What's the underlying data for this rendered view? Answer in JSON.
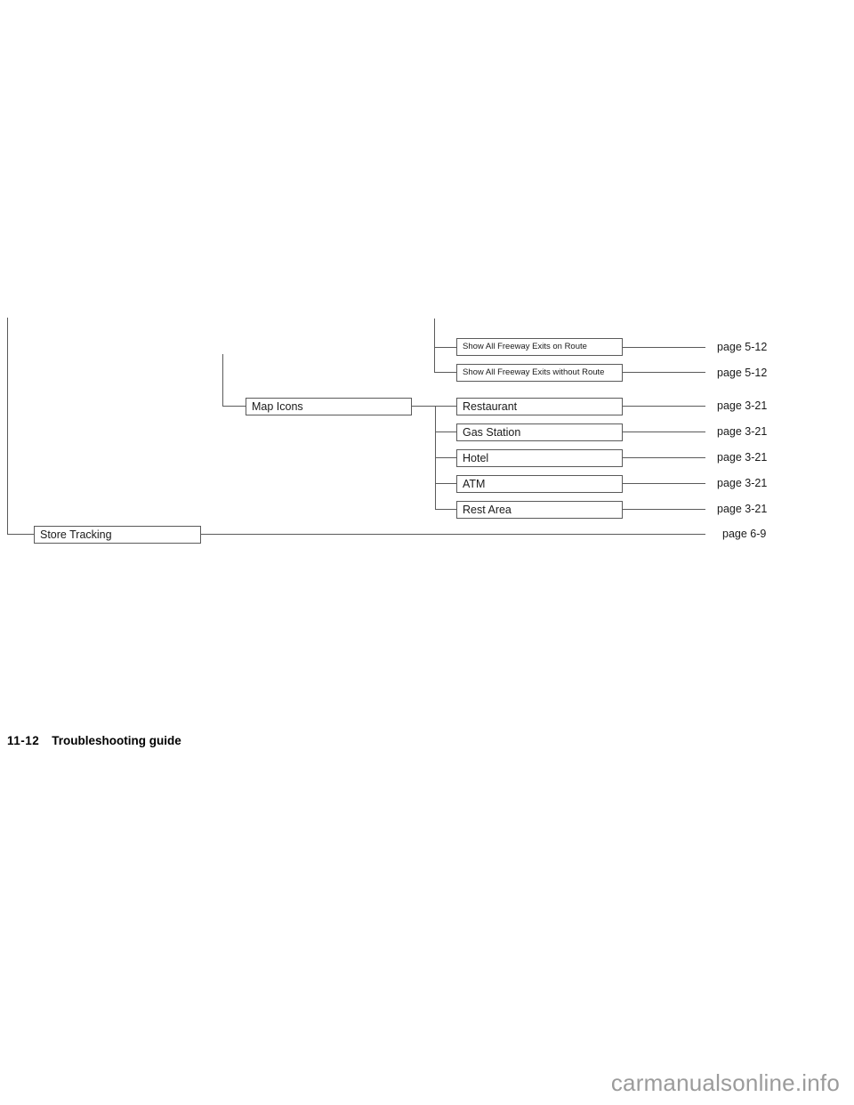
{
  "document": {
    "folio": "11-12",
    "chapter_title": "Troubleshooting guide",
    "watermark": "carmanualsonline.info"
  },
  "diagram": {
    "type": "menu-tree",
    "branches": [
      {
        "id": "freeway-exits",
        "nodes": [
          {
            "label": "Show All Freeway Exits on Route",
            "page_ref": "page 5-12"
          },
          {
            "label": "Show All Freeway Exits without Route",
            "page_ref": "page 5-12"
          }
        ]
      },
      {
        "id": "map-icons",
        "parent": {
          "label": "Map Icons"
        },
        "nodes": [
          {
            "label": "Restaurant",
            "page_ref": "page 3-21"
          },
          {
            "label": "Gas Station",
            "page_ref": "page 3-21"
          },
          {
            "label": "Hotel",
            "page_ref": "page 3-21"
          },
          {
            "label": "ATM",
            "page_ref": "page 3-21"
          },
          {
            "label": "Rest Area",
            "page_ref": "page 3-21"
          }
        ]
      },
      {
        "id": "store-tracking",
        "nodes": [
          {
            "label": "Store Tracking",
            "page_ref": "page 6-9"
          }
        ]
      }
    ]
  },
  "colors": {
    "line": "#5a5a5a",
    "text": "#1a1a1a",
    "watermark": "#9b9b9b",
    "background": "#ffffff"
  }
}
